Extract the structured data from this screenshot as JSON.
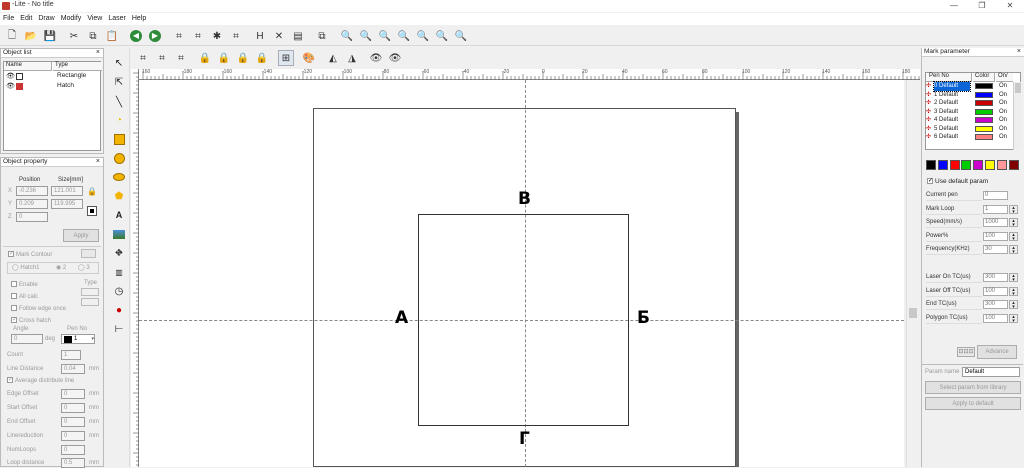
{
  "app": {
    "title": "-Lite - No title",
    "icon": "app-logo-icon"
  },
  "window_controls": {
    "minimize": "—",
    "maximize": "❐",
    "close": "✕"
  },
  "menu": [
    "File",
    "Edit",
    "Draw",
    "Modify",
    "View",
    "Laser",
    "Help"
  ],
  "object_list": {
    "title": "Object list",
    "close": "×",
    "col_name": "Name",
    "col_type": "Type",
    "rows": [
      {
        "type": "Rectangle"
      },
      {
        "type": "Hatch"
      }
    ]
  },
  "object_property": {
    "title": "Object property",
    "close": "×",
    "position_label": "Position",
    "size_label": "Size[mm]",
    "x_label": "X",
    "y_label": "Y",
    "z_label": "Z",
    "x": "-0.236",
    "y": "0.209",
    "z": "0",
    "w": "121.001",
    "h": "119.995",
    "apply": "Apply",
    "mark_contour": "Mark Contour",
    "hatch1": "Hatch1",
    "hatch2": "2",
    "hatch3": "3",
    "enable": "Enable",
    "type": "Type",
    "all_calc": "All calc",
    "follow_edge": "Follow edge once",
    "cross_hatch": "Cross hatch",
    "angle": "Angle",
    "angle_val": "0",
    "deg": "deg",
    "pen_no": "Pen No",
    "pen_val": "1",
    "count": "Count",
    "count_val": "1",
    "line_distance": "Line Distance",
    "line_distance_val": "0.04",
    "mm": "mm",
    "avg_distribute": "Average distribute line",
    "edge_offset": "Edge Offset",
    "edge_offset_val": "0",
    "start_offset": "Start Offset",
    "start_offset_val": "0",
    "end_offset": "End Offset",
    "end_offset_val": "0",
    "line_reduction": "Linereduction",
    "line_reduction_val": "0",
    "num_loops": "NumLoops",
    "num_loops_val": "0",
    "loop_distance": "Loop distance",
    "loop_distance_val": "0.5"
  },
  "ruler": {
    "labels": [
      "160",
      "-180",
      "-160",
      "-140",
      "-120",
      "-100",
      "-80",
      "-60",
      "-40",
      "-20",
      "0",
      "20",
      "40",
      "60",
      "80",
      "100",
      "120",
      "140",
      "160",
      "180"
    ]
  },
  "canvas": {
    "label_top": "В",
    "label_left": "А",
    "label_right": "Б",
    "label_bottom": "Г"
  },
  "mark_parameter": {
    "title": "Mark parameter",
    "close": "×",
    "col_pen": "Pen No",
    "col_color": "Color",
    "col_onoff": "On/",
    "pens": [
      {
        "name": "0 Default",
        "color": "#000000",
        "on": "On"
      },
      {
        "name": "1 Default",
        "color": "#0000ff",
        "on": "On"
      },
      {
        "name": "2 Default",
        "color": "#cc0000",
        "on": "On"
      },
      {
        "name": "3 Default",
        "color": "#00cc00",
        "on": "On"
      },
      {
        "name": "4 Default",
        "color": "#cc00cc",
        "on": "On"
      },
      {
        "name": "5 Default",
        "color": "#ffff00",
        "on": "On"
      },
      {
        "name": "6 Default",
        "color": "#ff8080",
        "on": "On"
      }
    ],
    "swatches": [
      "#000000",
      "#0000ff",
      "#ff0000",
      "#00cc00",
      "#cc00cc",
      "#ffff00",
      "#ff9999",
      "#800000"
    ],
    "use_default": "Use default param",
    "params": [
      {
        "label": "Current pen",
        "value": "0"
      },
      {
        "label": "Mark Loop",
        "value": "1"
      },
      {
        "label": "Speed(mm/s)",
        "value": "1000"
      },
      {
        "label": "Power%",
        "value": "100"
      },
      {
        "label": "Frequency(KHz)",
        "value": "30"
      }
    ],
    "params2": [
      {
        "label": "Laser On TC(us)",
        "value": "300"
      },
      {
        "label": "Laser Off TC(us)",
        "value": "100"
      },
      {
        "label": "End TC(us)",
        "value": "300"
      },
      {
        "label": "Polygon TC(us)",
        "value": "100"
      }
    ],
    "advance": "Advance",
    "param_name_label": "Param name",
    "param_name": "Default",
    "select_param": "Select param from library",
    "apply_default": "Apply to default"
  }
}
